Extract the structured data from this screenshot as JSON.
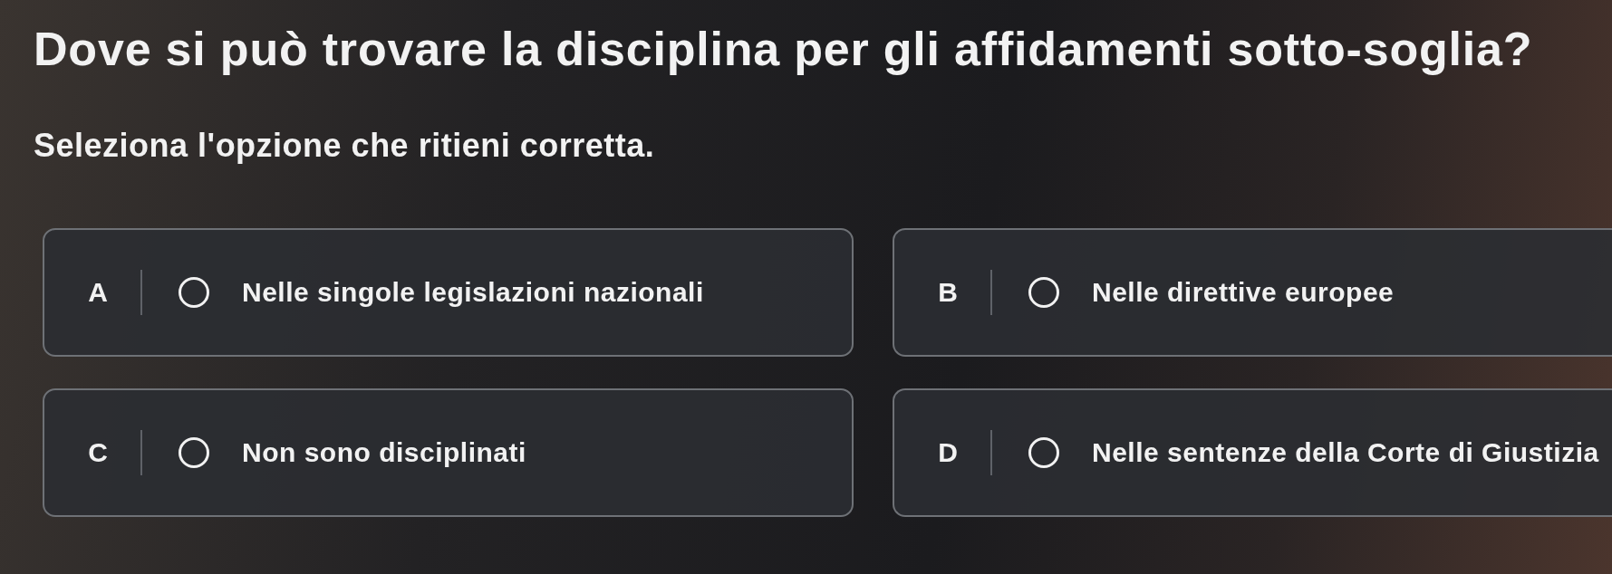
{
  "question": {
    "title": "Dove si può trovare la disciplina per gli affidamenti sotto-soglia?",
    "instruction": "Seleziona l'opzione che ritieni corretta."
  },
  "options": [
    {
      "letter": "A",
      "text": "Nelle singole legislazioni nazionali",
      "selected": false
    },
    {
      "letter": "B",
      "text": "Nelle direttive europee",
      "selected": false
    },
    {
      "letter": "C",
      "text": "Non sono disciplinati",
      "selected": false
    },
    {
      "letter": "D",
      "text": "Nelle sentenze della Corte di Giustizia",
      "selected": false
    }
  ]
}
